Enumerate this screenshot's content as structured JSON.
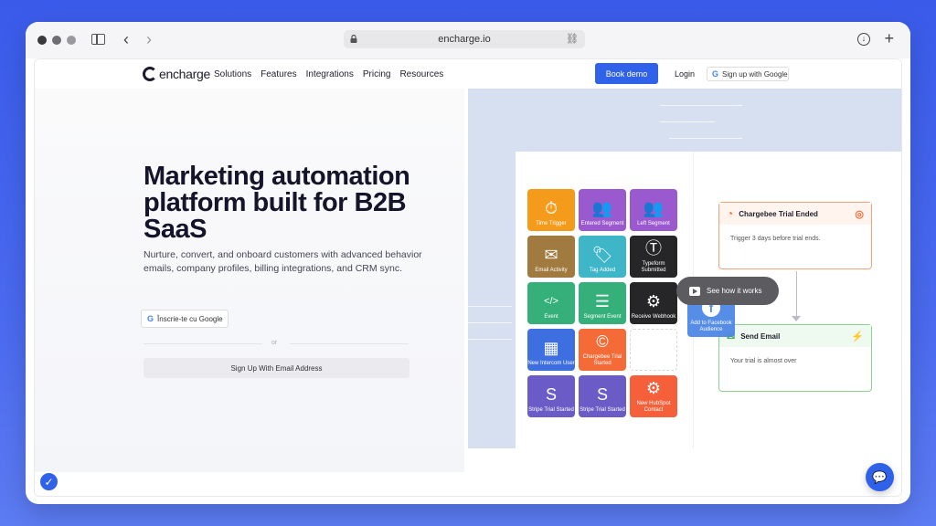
{
  "browser": {
    "url": "encharge.io"
  },
  "nav": {
    "logo": "encharge",
    "menu": [
      "Solutions",
      "Features",
      "Integrations",
      "Pricing",
      "Resources"
    ],
    "book_demo": "Book demo",
    "login": "Login",
    "google_signup": "Sign up with Google"
  },
  "hero": {
    "title": "Marketing automation platform built for B2B SaaS",
    "subtitle": "Nurture, convert, and onboard customers with advanced behavior emails, company profiles, billing integrations, and CRM sync.",
    "google_cta": "Înscrie-te cu Google",
    "or": "or",
    "email_cta": "Sign Up With Email Address"
  },
  "tiles": [
    {
      "label": "Time Trigger",
      "color": "#f59b1c",
      "icon": "timer-icon"
    },
    {
      "label": "Entered Segment",
      "color": "#9b59d0",
      "icon": "segment-enter-icon"
    },
    {
      "label": "Left Segment",
      "color": "#9b59d0",
      "icon": "segment-left-icon"
    },
    {
      "label": "Email Activity",
      "color": "#a07a3e",
      "icon": "email-icon"
    },
    {
      "label": "Tag Added",
      "color": "#3fb6c8",
      "icon": "tag-icon"
    },
    {
      "label": "Typeform Submitted",
      "color": "#262628",
      "icon": "typeform-icon"
    },
    {
      "label": "Event",
      "color": "#35b07a",
      "icon": "code-icon"
    },
    {
      "label": "Segment Event",
      "color": "#35b07a",
      "icon": "segment-event-icon"
    },
    {
      "label": "Receive Webhook",
      "color": "#262628",
      "icon": "webhook-icon"
    },
    {
      "label": "New Intercom User",
      "color": "#3e6fe0",
      "icon": "intercom-icon"
    },
    {
      "label": "Chargebee Trial Started",
      "color": "#f56b37",
      "icon": "chargebee-icon"
    },
    {
      "label": "",
      "color": "",
      "icon": ""
    },
    {
      "label": "Stripe Trial Started",
      "color": "#6b5bc6",
      "icon": "stripe-icon"
    },
    {
      "label": "Stripe Trial Started",
      "color": "#6b5bc6",
      "icon": "stripe-icon"
    },
    {
      "label": "New HubSpot Contact",
      "color": "#f5603a",
      "icon": "hubspot-icon"
    }
  ],
  "flow": {
    "card1_title": "Chargebee Trial Ended",
    "card1_body": "Trigger 3 days before trial ends.",
    "card2_title": "Send Email",
    "card2_body": "Your trial is almost over",
    "see_how": "See how it works",
    "fb_label": "Add to Facebook Audience"
  }
}
